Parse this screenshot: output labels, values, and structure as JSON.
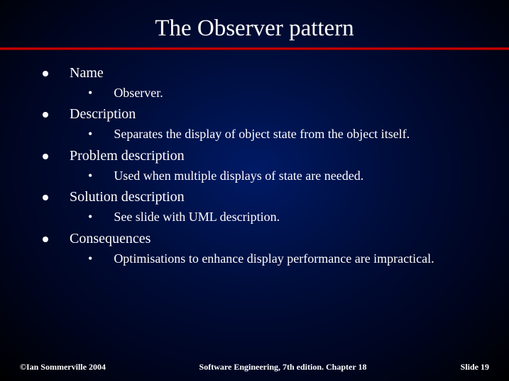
{
  "title": "The Observer pattern",
  "items": [
    {
      "label": "Name",
      "sub": "Observer."
    },
    {
      "label": "Description",
      "sub": "Separates the display of object state from the object itself."
    },
    {
      "label": "Problem description",
      "sub": "Used when multiple displays of state are needed."
    },
    {
      "label": "Solution description",
      "sub": "See slide with UML description."
    },
    {
      "label": "Consequences",
      "sub": "Optimisations to enhance display performance are impractical."
    }
  ],
  "footer": {
    "left": "©Ian Sommerville 2004",
    "center": "Software Engineering, 7th edition. Chapter 18",
    "right": "Slide  19"
  }
}
